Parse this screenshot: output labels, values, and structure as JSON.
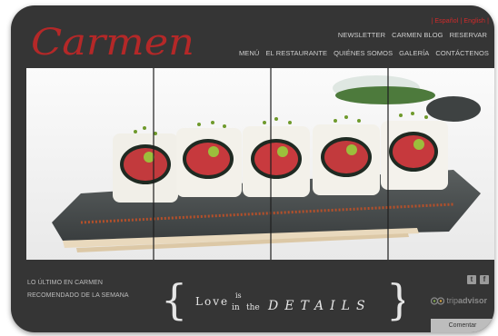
{
  "brand": {
    "logo_text": "Carmen"
  },
  "languages": [
    "Español",
    "English"
  ],
  "top_nav": [
    "NEWSLETTER",
    "CARMEN BLOG",
    "RESERVAR"
  ],
  "main_nav": [
    "MENÚ",
    "EL RESTAURANTE",
    "QUIÉNES SOMOS",
    "GALERÍA",
    "CONTÁCTENOS"
  ],
  "bottom_links": [
    "LO ÚLTIMO EN CARMEN",
    "RECOMENDADO DE LA SEMANA"
  ],
  "tagline": {
    "w1": "Love",
    "w2": "is",
    "w3": "in",
    "w4": "the",
    "w5": "DETAILS"
  },
  "social": {
    "twitter": "t",
    "facebook": "f"
  },
  "tripadvisor": {
    "text_plain": "trip",
    "text_bold": "advisor"
  },
  "comment_button": "Comentar",
  "colors": {
    "frame": "#353535",
    "accent": "#d12a2a",
    "nav_text": "#cfcfcf"
  }
}
